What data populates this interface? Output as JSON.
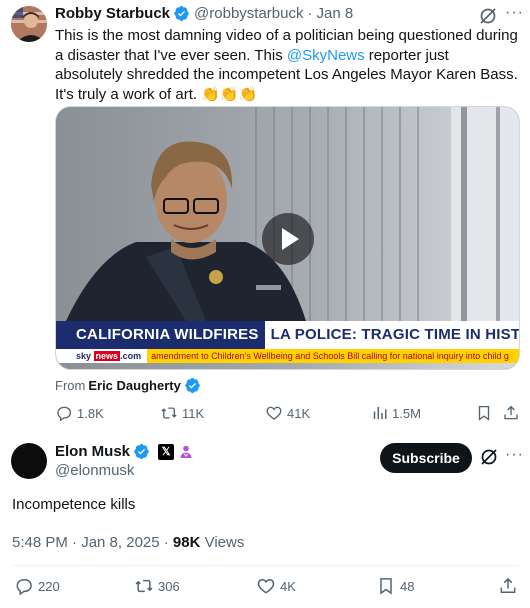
{
  "quoted_post": {
    "author_name": "Robby Starbuck",
    "author_handle": "@robbystarbuck",
    "date": "Jan 8",
    "text_before": "This is the most damning video of a politician being questioned during a disaster that I've ever seen. This ",
    "mention": "@SkyNews",
    "text_after": " reporter just absolutely shredded the incompetent Los Angeles Mayor Karen Bass. It's truly a work of art. ",
    "emoji": "👏👏👏",
    "video": {
      "banner_left": "CALIFORNIA WILDFIRES",
      "banner_right": "LA POLICE: TRAGIC TIME IN HISTORY",
      "logo_sky": "sky",
      "logo_news": "news",
      "logo_com": ".com",
      "ticker": "amendment to Children's Wellbeing and Schools Bill calling for national inquiry into child g"
    },
    "from_label": "From",
    "from_name": "Eric Daugherty",
    "stats": {
      "replies": "1.8K",
      "reposts": "11K",
      "likes": "41K",
      "views": "1.5M"
    }
  },
  "main_post": {
    "author_name": "Elon Musk",
    "author_handle": "@elonmusk",
    "x_badge": "𝕏",
    "subscribe_label": "Subscribe",
    "text": "Incompetence kills",
    "time": "5:48 PM · Jan 8, 2025 · ",
    "views_count": "98K",
    "views_label": " Views",
    "stats": {
      "replies": "220",
      "reposts": "306",
      "likes": "4K",
      "bookmarks": "48"
    }
  },
  "icons": [
    "verified-badge-icon",
    "grok-icon",
    "more-icon",
    "play-icon",
    "reply-icon",
    "repost-icon",
    "like-icon",
    "views-icon",
    "bookmark-icon",
    "share-icon",
    "x-badge-icon",
    "affiliate-icon"
  ],
  "colors": {
    "accent": "#1d9bf0",
    "text": "#0f1419",
    "muted": "#536471",
    "sky_blue": "#1b2d6e",
    "sky_red": "#d6001c",
    "ticker_yellow": "#ffd200"
  }
}
